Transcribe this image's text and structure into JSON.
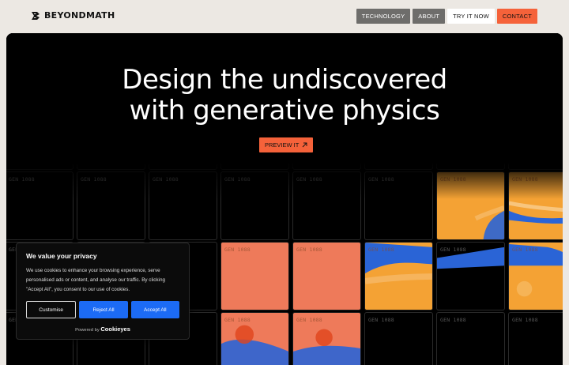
{
  "header": {
    "brand": "BEYONDMATH",
    "nav": [
      "TECHNOLOGY",
      "ABOUT",
      "TRY IT NOW",
      "CONTACT"
    ]
  },
  "hero": {
    "headline_line1": "Design the undiscovered",
    "headline_line2": "with generative physics",
    "cta": "PREVIEW IT",
    "cell_label": "GEN 1088"
  },
  "cookie_banner": {
    "title": "We value your privacy",
    "text": "We use cookies to enhance your browsing experience, serve personalised ads or content, and analyse our traffic. By clicking \"Accept All\", you consent to our use of cookies.",
    "customise": "Customise",
    "reject": "Reject All",
    "accept": "Accept All",
    "powered_by": "Powered by",
    "provider": "Cookieyes"
  },
  "colors": {
    "accent": "#f5623a",
    "sim_orange": "#f4a234",
    "sim_salmon": "#ee7a5a",
    "sim_blue": "#2a64d6",
    "cookie_blue": "#1c6bf5"
  }
}
